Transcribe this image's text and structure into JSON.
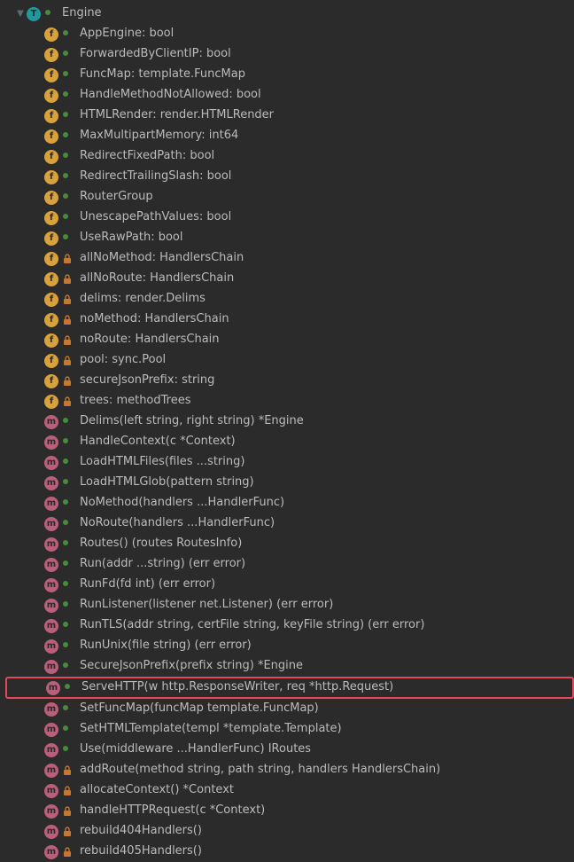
{
  "root": {
    "name": "Engine",
    "icon": "T",
    "access": "public",
    "expanded": true
  },
  "members": [
    {
      "kind": "f",
      "access": "public",
      "label": "AppEngine: bool"
    },
    {
      "kind": "f",
      "access": "public",
      "label": "ForwardedByClientIP: bool"
    },
    {
      "kind": "f",
      "access": "public",
      "label": "FuncMap: template.FuncMap"
    },
    {
      "kind": "f",
      "access": "public",
      "label": "HandleMethodNotAllowed: bool"
    },
    {
      "kind": "f",
      "access": "public",
      "label": "HTMLRender: render.HTMLRender"
    },
    {
      "kind": "f",
      "access": "public",
      "label": "MaxMultipartMemory: int64"
    },
    {
      "kind": "f",
      "access": "public",
      "label": "RedirectFixedPath: bool"
    },
    {
      "kind": "f",
      "access": "public",
      "label": "RedirectTrailingSlash: bool"
    },
    {
      "kind": "f",
      "access": "public",
      "label": "RouterGroup"
    },
    {
      "kind": "f",
      "access": "public",
      "label": "UnescapePathValues: bool"
    },
    {
      "kind": "f",
      "access": "public",
      "label": "UseRawPath: bool"
    },
    {
      "kind": "f",
      "access": "private",
      "label": "allNoMethod: HandlersChain"
    },
    {
      "kind": "f",
      "access": "private",
      "label": "allNoRoute: HandlersChain"
    },
    {
      "kind": "f",
      "access": "private",
      "label": "delims: render.Delims"
    },
    {
      "kind": "f",
      "access": "private",
      "label": "noMethod: HandlersChain"
    },
    {
      "kind": "f",
      "access": "private",
      "label": "noRoute: HandlersChain"
    },
    {
      "kind": "f",
      "access": "private",
      "label": "pool: sync.Pool"
    },
    {
      "kind": "f",
      "access": "private",
      "label": "secureJsonPrefix: string"
    },
    {
      "kind": "f",
      "access": "private",
      "label": "trees: methodTrees"
    },
    {
      "kind": "m",
      "access": "public",
      "label": "Delims(left string, right string) *Engine"
    },
    {
      "kind": "m",
      "access": "public",
      "label": "HandleContext(c *Context)"
    },
    {
      "kind": "m",
      "access": "public",
      "label": "LoadHTMLFiles(files ...string)"
    },
    {
      "kind": "m",
      "access": "public",
      "label": "LoadHTMLGlob(pattern string)"
    },
    {
      "kind": "m",
      "access": "public",
      "label": "NoMethod(handlers ...HandlerFunc)"
    },
    {
      "kind": "m",
      "access": "public",
      "label": "NoRoute(handlers ...HandlerFunc)"
    },
    {
      "kind": "m",
      "access": "public",
      "label": "Routes() (routes RoutesInfo)"
    },
    {
      "kind": "m",
      "access": "public",
      "label": "Run(addr ...string) (err error)"
    },
    {
      "kind": "m",
      "access": "public",
      "label": "RunFd(fd int) (err error)"
    },
    {
      "kind": "m",
      "access": "public",
      "label": "RunListener(listener net.Listener) (err error)"
    },
    {
      "kind": "m",
      "access": "public",
      "label": "RunTLS(addr string, certFile string, keyFile string) (err error)"
    },
    {
      "kind": "m",
      "access": "public",
      "label": "RunUnix(file string) (err error)"
    },
    {
      "kind": "m",
      "access": "public",
      "label": "SecureJsonPrefix(prefix string) *Engine"
    },
    {
      "kind": "m",
      "access": "public",
      "label": "ServeHTTP(w http.ResponseWriter, req *http.Request)",
      "highlight": true
    },
    {
      "kind": "m",
      "access": "public",
      "label": "SetFuncMap(funcMap template.FuncMap)"
    },
    {
      "kind": "m",
      "access": "public",
      "label": "SetHTMLTemplate(templ *template.Template)"
    },
    {
      "kind": "m",
      "access": "public",
      "label": "Use(middleware ...HandlerFunc) IRoutes"
    },
    {
      "kind": "m",
      "access": "private",
      "label": "addRoute(method string, path string, handlers HandlersChain)"
    },
    {
      "kind": "m",
      "access": "private",
      "label": "allocateContext() *Context"
    },
    {
      "kind": "m",
      "access": "private",
      "label": "handleHTTPRequest(c *Context)"
    },
    {
      "kind": "m",
      "access": "private",
      "label": "rebuild404Handlers()"
    },
    {
      "kind": "m",
      "access": "private",
      "label": "rebuild405Handlers()"
    }
  ],
  "glyphs": {
    "expanded_arrow": "▼",
    "public": "🞃",
    "private": "🔒"
  }
}
